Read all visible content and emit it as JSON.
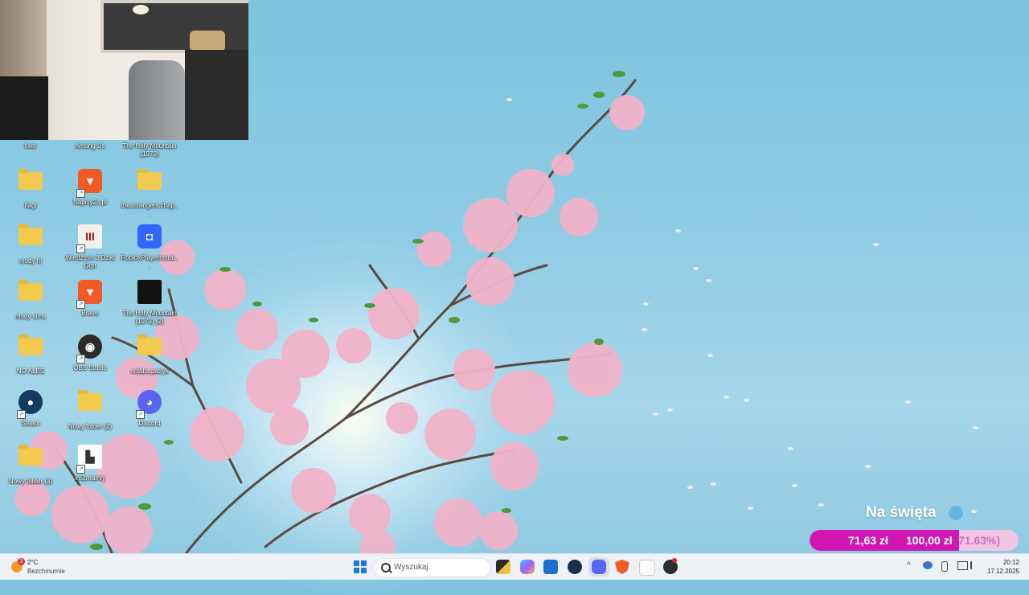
{
  "webcam": {
    "name": "webcam-overlay"
  },
  "desktop": {
    "icons": [
      {
        "label": "fixer",
        "kind": "folder"
      },
      {
        "label": "Among Us",
        "kind": "app"
      },
      {
        "label": "The Holy Mountain (1973)",
        "kind": "video"
      },
      {
        "label": "flagi",
        "kind": "folder"
      },
      {
        "label": "Napisy24.pl",
        "kind": "brave"
      },
      {
        "label": "the.strangers.chap...",
        "kind": "folder"
      },
      {
        "label": "mody hl",
        "kind": "folder"
      },
      {
        "label": "Wiedźmin 3 Dziki Gon",
        "kind": "witcher"
      },
      {
        "label": "RobloxPlayerInstal...",
        "kind": "roblox"
      },
      {
        "label": "mody sims",
        "kind": "folder"
      },
      {
        "label": "Brave",
        "kind": "brave"
      },
      {
        "label": "The Holy Mountain (1973) (2)",
        "kind": "video"
      },
      {
        "label": "NO ALBS",
        "kind": "folder"
      },
      {
        "label": "OBS Studio",
        "kind": "obs"
      },
      {
        "label": "nolabs.patryk",
        "kind": "folder"
      },
      {
        "label": "Steam",
        "kind": "steam"
      },
      {
        "label": "Nowy folder (2)",
        "kind": "folder"
      },
      {
        "label": "Discord",
        "kind": "discord"
      },
      {
        "label": "Nowy folder (3)",
        "kind": "folder"
      },
      {
        "label": "inStreamly",
        "kind": "instreamly"
      }
    ]
  },
  "goal_widget": {
    "title": "Na święta",
    "current": "71,63 zł",
    "target": "100,00 zł",
    "percent_label": "71.63%)",
    "progress": 0.7163,
    "fill_color": "#d216b4",
    "track_color": "#f2c4e6"
  },
  "taskbar": {
    "weather": {
      "badge": "3",
      "temp": "2°C",
      "desc": "Bezchmurnie"
    },
    "search_placeholder": "Wyszukaj",
    "apps": [
      "file-explorer-icon",
      "copilot-icon",
      "microsoft-store-icon",
      "steam-icon",
      "discord-icon",
      "brave-icon",
      "instreamly-icon",
      "obs-icon"
    ],
    "tray_chevron": "^",
    "time": "20:12",
    "date": "17.12.2025"
  }
}
